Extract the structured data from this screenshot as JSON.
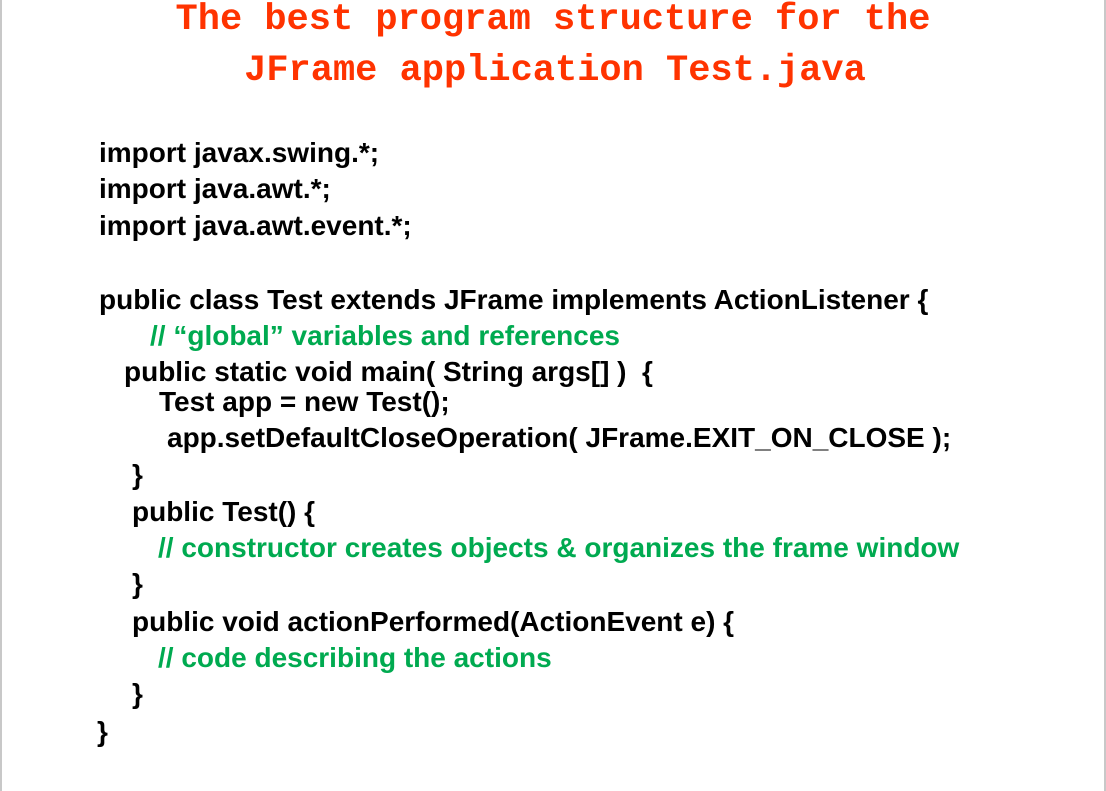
{
  "title": {
    "line1": "The best program structure for the",
    "line2": "JFrame application Test.java"
  },
  "code": {
    "import1": "import javax.swing.*;",
    "import2": "import java.awt.*;",
    "import3": "import java.awt.event.*;",
    "class_decl": "public class Test extends JFrame implements ActionListener {",
    "comment_global": "// “global” variables and references",
    "main_decl": "public static void main( String args[] )  {",
    "main_body1": "Test app = new Test();",
    "main_body2": "app.setDefaultCloseOperation( JFrame.EXIT_ON_CLOSE );",
    "main_close": "}",
    "ctor_decl": "public Test() {",
    "comment_ctor": "// constructor creates objects & organizes the frame window",
    "ctor_close": "}",
    "action_decl": "public void actionPerformed(ActionEvent e) {",
    "comment_action": "// code describing the actions",
    "action_close": "}",
    "class_close": "}"
  },
  "colors": {
    "title": "#ff3300",
    "code": "#000000",
    "comment": "#00aa50"
  }
}
